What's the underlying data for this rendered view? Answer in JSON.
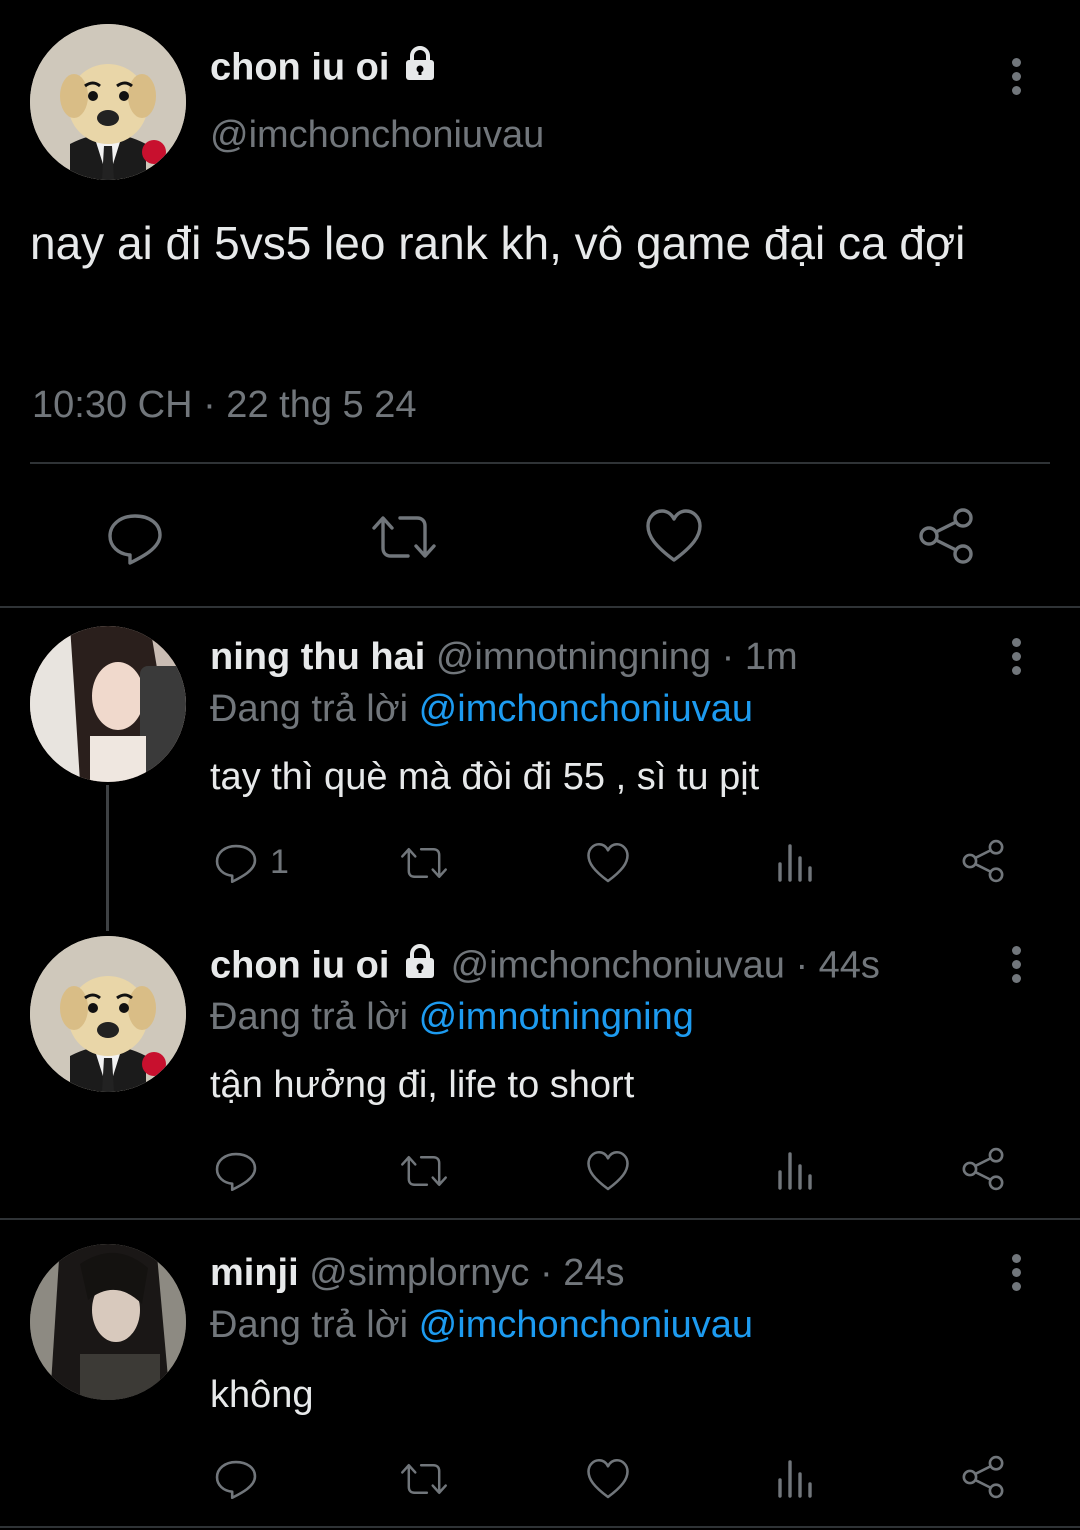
{
  "main_tweet": {
    "display_name": "chon iu oi",
    "handle": "@imchonchoniuvau",
    "text": "nay ai đi 5vs5 leo rank kh, vô game đại ca đợi",
    "timestamp": "10:30 CH · 22 thg 5 24",
    "protected": true
  },
  "replies": [
    {
      "display_name": "ning thu hai",
      "handle": "@imnotningning",
      "time": "· 1m",
      "replying_label": "Đang trả lời",
      "replying_to": "@imchonchoniuvau",
      "text": "tay thì què mà đòi đi 55 , sì tu pịt",
      "reply_count": "1"
    },
    {
      "display_name": "chon iu oi",
      "handle": "@imchonchoniuvau",
      "time": "· 44s",
      "replying_label": "Đang trả lời",
      "replying_to": "@imnotningning",
      "text": "tận hưởng đi, life to short",
      "reply_count": "",
      "protected": true
    },
    {
      "display_name": "minji",
      "handle": "@simplornyc",
      "time": "· 24s",
      "replying_label": "Đang trả lời",
      "replying_to": "@imchonchoniuvau",
      "text": "không",
      "reply_count": ""
    }
  ],
  "icons": {
    "lock": "lock-icon",
    "more": "more-vertical-icon",
    "reply": "reply-icon",
    "retweet": "retweet-icon",
    "like": "heart-icon",
    "views": "views-icon",
    "share": "share-icon"
  },
  "colors": {
    "background": "#000000",
    "text": "#e7e9ea",
    "muted": "#71767b",
    "link": "#1d9bf0",
    "divider": "#2f3336"
  }
}
